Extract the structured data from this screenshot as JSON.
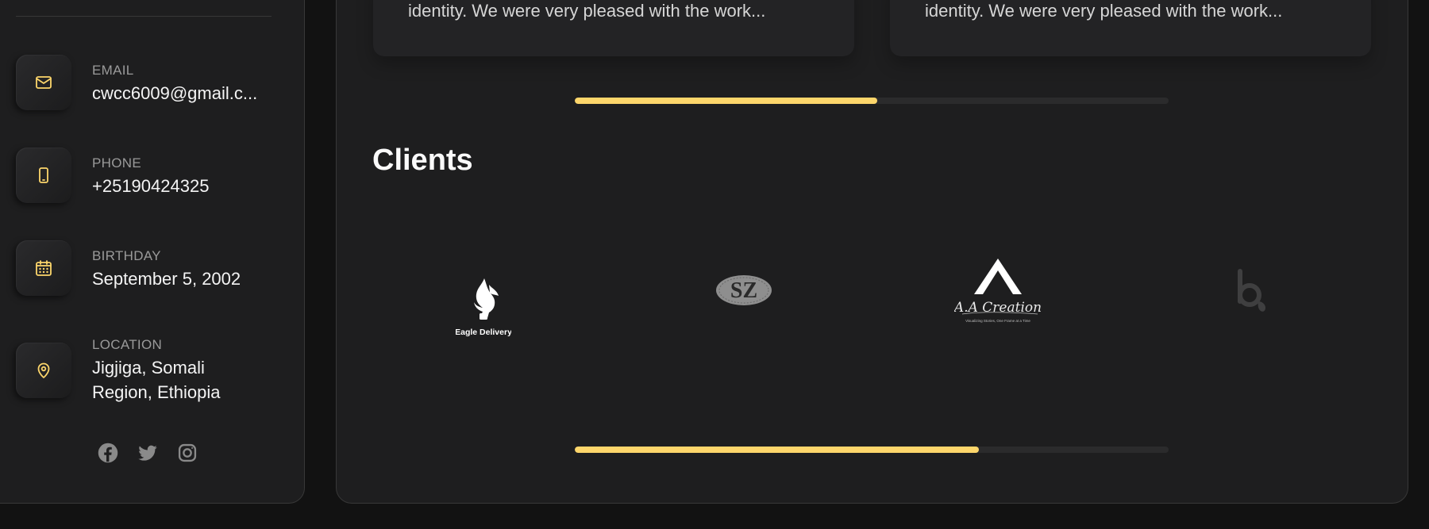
{
  "contacts": {
    "email": {
      "label": "EMAIL",
      "value": "cwcc6009@gmail.c...",
      "icon": "mail-icon"
    },
    "phone": {
      "label": "PHONE",
      "value": "+25190424325",
      "icon": "phone-icon"
    },
    "birthday": {
      "label": "BIRTHDAY",
      "value": "September 5, 2002",
      "icon": "calendar-icon"
    },
    "location": {
      "label": "LOCATION",
      "value_line1": "Jigjiga, Somali",
      "value_line2": "Region, Ethiopia",
      "icon": "location-pin-icon"
    }
  },
  "socials": [
    "facebook-icon",
    "twitter-icon",
    "instagram-icon"
  ],
  "testimonials": [
    {
      "text": "identity. We were very pleased with the work..."
    },
    {
      "text": "identity. We were very pleased with the work..."
    }
  ],
  "testimonials_scroll_progress": 0.51,
  "clients": {
    "title": "Clients",
    "logos": [
      {
        "name": "Eagle Delivery",
        "text": "Eagle Delivery"
      },
      {
        "name": "SZ monogram",
        "text": "SZ"
      },
      {
        "name": "A.A Creation",
        "text": "A.A Creation",
        "tagline": "Visualizing Stories, One Frame at a Time"
      },
      {
        "name": "b logo",
        "text": "b"
      }
    ],
    "scroll_progress": 0.68
  },
  "colors": {
    "accent": "#fdd66b",
    "card_bg": "#1e1e1f",
    "page_bg": "#121212",
    "border": "#383838",
    "text_primary": "#f4f4f4",
    "text_secondary": "#9a9a9a"
  }
}
